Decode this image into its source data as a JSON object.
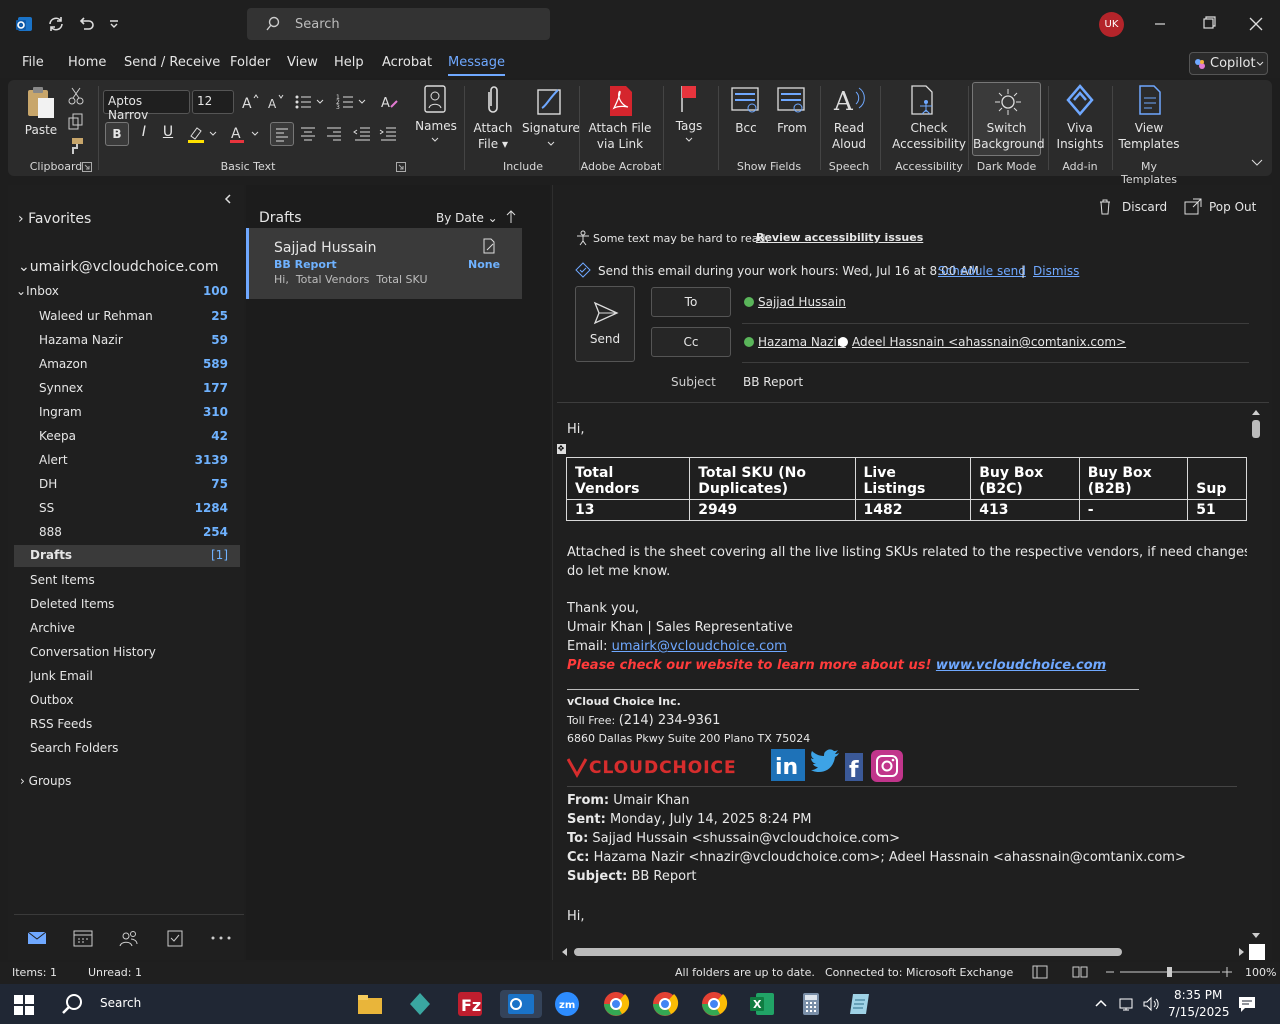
{
  "titlebar": {
    "search_placeholder": "Search",
    "avatar_initials": "UK"
  },
  "menu": {
    "items": [
      "File",
      "Home",
      "Send / Receive",
      "Folder",
      "View",
      "Help",
      "Acrobat",
      "Message"
    ],
    "active": "Message",
    "copilot": "Copilot"
  },
  "ribbon": {
    "paste": "Paste",
    "font_name": "Aptos Narrov",
    "font_size": "12",
    "bold": "B",
    "italic": "I",
    "underline": "U",
    "names": "Names",
    "attach_file_1": "Attach",
    "attach_file_2": "File",
    "signature": "Signature",
    "attach_link_1": "Attach File",
    "attach_link_2": "via Link",
    "tags": "Tags",
    "bcc": "Bcc",
    "from": "From",
    "read_aloud_1": "Read",
    "read_aloud_2": "Aloud",
    "check_access_1": "Check",
    "check_access_2": "Accessibility",
    "switch_bg_1": "Switch",
    "switch_bg_2": "Background",
    "viva_1": "Viva",
    "viva_2": "Insights",
    "view_tpl_1": "View",
    "view_tpl_2": "Templates",
    "groups": {
      "clipboard": "Clipboard",
      "basic_text": "Basic Text",
      "include": "Include",
      "adobe": "Adobe Acrobat",
      "show_fields": "Show Fields",
      "speech": "Speech",
      "accessibility": "Accessibility",
      "dark_mode": "Dark Mode",
      "addin": "Add-in",
      "templates": "My Templates"
    }
  },
  "nav": {
    "favorites": "Favorites",
    "account": "umairk@vcloudchoice.com",
    "inbox": {
      "label": "Inbox",
      "count": "100"
    },
    "subfolders": [
      {
        "label": "Waleed ur Rehman",
        "count": "25"
      },
      {
        "label": "Hazama Nazir",
        "count": "59"
      },
      {
        "label": "Amazon",
        "count": "589"
      },
      {
        "label": "Synnex",
        "count": "177"
      },
      {
        "label": "Ingram",
        "count": "310"
      },
      {
        "label": "Keepa",
        "count": "42"
      },
      {
        "label": "Alert",
        "count": "3139"
      },
      {
        "label": "DH",
        "count": "75"
      },
      {
        "label": "SS",
        "count": "1284"
      },
      {
        "label": "888",
        "count": "254"
      }
    ],
    "drafts": {
      "label": "Drafts",
      "count": "[1]"
    },
    "folders": [
      "Sent Items",
      "Deleted Items",
      "Archive",
      "Conversation History",
      "Junk Email",
      "Outbox",
      "RSS Feeds",
      "Search Folders"
    ],
    "groups": "Groups"
  },
  "list": {
    "title": "Drafts",
    "sort": "By Date",
    "item": {
      "sender": "Sajjad Hussain",
      "subject": "BB Report",
      "category": "None",
      "preview": "Hi,  Total Vendors  Total SKU"
    }
  },
  "compose": {
    "discard": "Discard",
    "popout": "Pop Out",
    "access_msg": "Some text may be hard to read.",
    "access_link": "Review accessibility issues",
    "sched_msg": "Send this email during your work hours: Wed, Jul 16 at 8:00 AM",
    "sched_link": "Schedule send",
    "sched_sep": "|",
    "dismiss": "Dismiss",
    "send": "Send",
    "to_btn": "To",
    "cc_btn": "Cc",
    "to": "Sajjad Hussain",
    "cc1": "Hazama Nazir;",
    "cc2": "Adeel Hassnain <ahassnain@comtanix.com>",
    "subject_label": "Subject",
    "subject": "BB Report"
  },
  "body": {
    "greeting": "Hi,",
    "table_headers": [
      "Total Vendors",
      "Total SKU (No Duplicates)",
      "Live Listings",
      "Buy Box (B2C)",
      "Buy Box (B2B)",
      "Sup"
    ],
    "table_values": [
      "13",
      "2949",
      "1482",
      "413",
      "-",
      "51"
    ],
    "para1": "Attached is the sheet covering all the live listing SKUs related to the respective vendors, if need changes, please",
    "para2": "do let me know.",
    "thanks": "Thank you,",
    "sig_name": "Umair Khan | Sales Representative",
    "email_label": "Email: ",
    "email": "umairk@vcloudchoice.com",
    "promo": "Please check our website to learn more about us! ",
    "website": "www.vcloudchoice.com",
    "company": "vCloud Choice Inc.",
    "tollfree_label": "Toll Free: ",
    "tollfree": "(214) 234-9361",
    "address": "6860 Dallas Pkwy Suite 200 Plano TX 75024",
    "logo": "vCLOUDCHOICE",
    "from_label": "From:",
    "from": " Umair Khan",
    "sent_label": "Sent:",
    "sent": " Monday, July 14, 2025 8:24 PM",
    "to_label": "To:",
    "to": " Sajjad Hussain <shussain@vcloudchoice.com>",
    "cc_label": "Cc:",
    "cc": " Hazama Nazir <hnazir@vcloudchoice.com>; Adeel Hassnain <ahassnain@comtanix.com>",
    "subj_label": "Subject:",
    "subj": " BB Report",
    "greeting2": "Hi,"
  },
  "status": {
    "items": "Items: 1",
    "unread": "Unread: 1",
    "sync": "All folders are up to date.",
    "connected": "Connected to: Microsoft Exchange",
    "zoom": "100%"
  },
  "taskbar": {
    "search": "Search",
    "time": "8:35 PM",
    "date": "7/15/2025"
  }
}
